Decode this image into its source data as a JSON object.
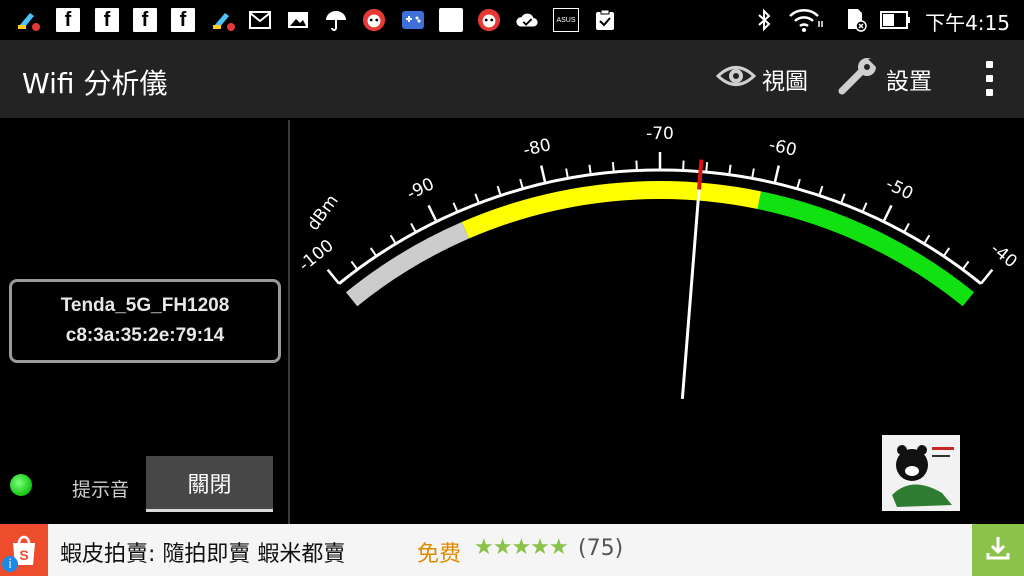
{
  "status_bar": {
    "clock": "下午4:15",
    "left_icons": [
      "broom-alert-icon",
      "facebook-icon",
      "facebook-icon",
      "facebook-icon",
      "facebook-icon",
      "broom-alert-icon",
      "mail-icon",
      "image-icon",
      "umbrella-icon",
      "mascot-notif-icon",
      "game-controller-icon",
      "blank-notif-icon",
      "mascot-notif-icon",
      "cloud-check-icon",
      "asus-icon",
      "clipboard-check-icon"
    ],
    "right_icons": [
      "bluetooth-icon",
      "wifi-icon",
      "sd-card-icon",
      "battery-icon"
    ],
    "brand_label": "ASUS"
  },
  "app_bar": {
    "title": "Wifi 分析儀",
    "view_label": "視圖",
    "settings_label": "設置"
  },
  "network": {
    "ssid": "Tenda_5G_FH1208",
    "bssid": "c8:3a:35:2e:79:14"
  },
  "beep": {
    "label": "提示音",
    "toggle_value": "關閉"
  },
  "gauge": {
    "unit_label": "dBm",
    "min": -100,
    "max": -40,
    "tick_labels": [
      "-100",
      "-90",
      "-80",
      "-70",
      "-60",
      "-50",
      "-40"
    ],
    "needle_value": -66.5,
    "zones": [
      {
        "from": -100,
        "to": -88,
        "color": "#cccccc"
      },
      {
        "from": -88,
        "to": -61,
        "color": "#ffff00"
      },
      {
        "from": -61,
        "to": -40,
        "color": "#11e011"
      }
    ],
    "needle_colors": {
      "tip": "#dd1111",
      "shaft": "#ffffff"
    }
  },
  "ad": {
    "title": "蝦皮拍賣: 隨拍即賣 蝦米都賣",
    "price": "免费",
    "stars": "★★★★★",
    "rating_count": "(75)",
    "colors": {
      "logo": "#ee4d2d",
      "install": "#8bc34a",
      "price": "#e08a00"
    }
  }
}
